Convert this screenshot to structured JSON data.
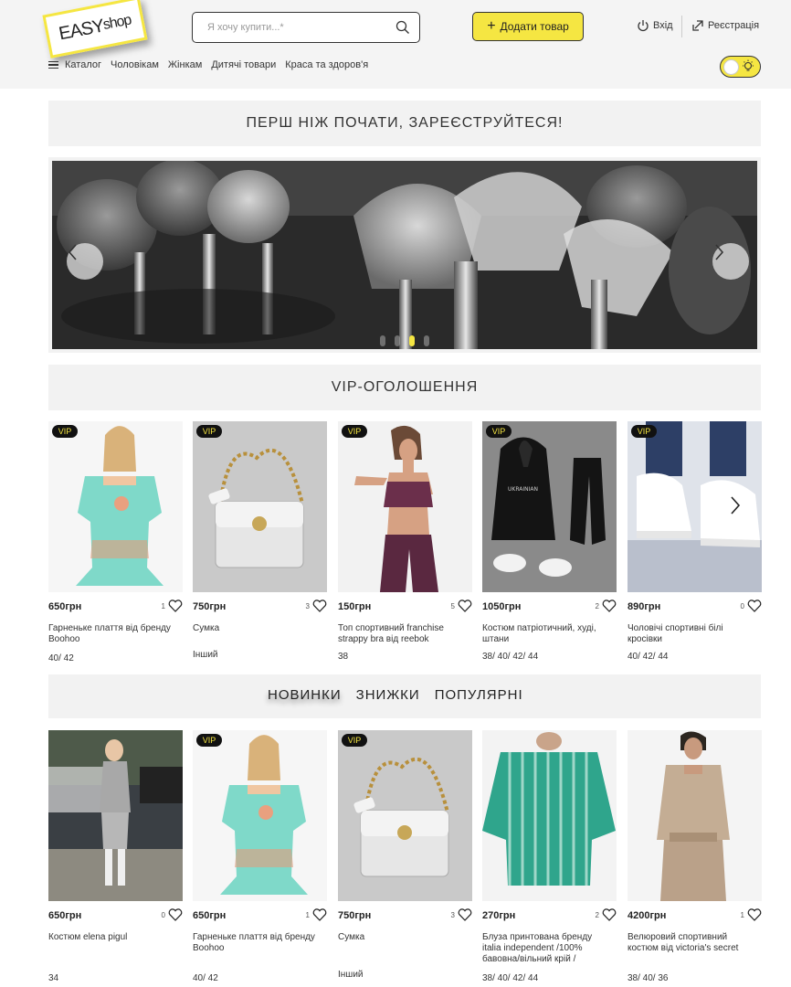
{
  "header": {
    "logo_main": "EASY",
    "logo_sub": "shop",
    "search_placeholder": "Я хочу купити...*",
    "add_button": "Додати товар",
    "login": "Вхід",
    "register": "Реєстрація",
    "nav": [
      "Каталог",
      "Чоловікам",
      "Жінкам",
      "Дитячі товари",
      "Краса та здоров'я"
    ],
    "accent_color": "#f5e642"
  },
  "banner": {
    "text": "ПЕРШ НІЖ ПОЧАТИ, ЗАРЕЄСТРУЙТЕСЯ!"
  },
  "slider": {
    "slides": 4,
    "active_slide": 3
  },
  "vip": {
    "title": "VIP-ОГОЛОШЕННЯ",
    "badge": "VIP",
    "items": [
      {
        "price": "650грн",
        "likes": "1",
        "title": "Гарненьке плаття від бренду Boohoo",
        "sizes": "40/ 42"
      },
      {
        "price": "750грн",
        "likes": "3",
        "title": "Сумка",
        "sizes": "Інший"
      },
      {
        "price": "150грн",
        "likes": "5",
        "title": "Топ спортивний franchise strappy bra від reebok",
        "sizes": "38"
      },
      {
        "price": "1050грн",
        "likes": "2",
        "title": "Костюм патріотичний, худі, штани",
        "sizes": "38/ 40/ 42/ 44"
      },
      {
        "price": "890грн",
        "likes": "0",
        "title": "Чоловічі спортивні білі кросівки",
        "sizes": "40/ 42/ 44"
      }
    ]
  },
  "tabs": {
    "items": [
      "НОВИНКИ",
      "ЗНИЖКИ",
      "ПОПУЛЯРНІ"
    ],
    "active": "НОВИНКИ"
  },
  "new_items": [
    {
      "price": "650грн",
      "likes": "0",
      "title": "Костюм elena pigul",
      "sizes": "34",
      "vip": false
    },
    {
      "price": "650грн",
      "likes": "1",
      "title": "Гарненьке плаття від бренду Boohoo",
      "sizes": "40/ 42",
      "vip": true
    },
    {
      "price": "750грн",
      "likes": "3",
      "title": "Сумка",
      "sizes": "Інший",
      "vip": true
    },
    {
      "price": "270грн",
      "likes": "2",
      "title": "Блуза принтована бренду italia independent /100% бавовна/вільний крій /",
      "sizes": "38/ 40/ 42/ 44",
      "vip": false
    },
    {
      "price": "4200грн",
      "likes": "1",
      "title": "Велюровий спортивний костюм від victoria's secret",
      "sizes": "38/ 40/ 36",
      "vip": false
    }
  ],
  "icons": [
    "search-icon",
    "plus-icon",
    "power-icon",
    "login-arrow-icon",
    "menu-icon",
    "bulb-icon",
    "heart-icon",
    "chevron-left-icon",
    "chevron-right-icon"
  ]
}
